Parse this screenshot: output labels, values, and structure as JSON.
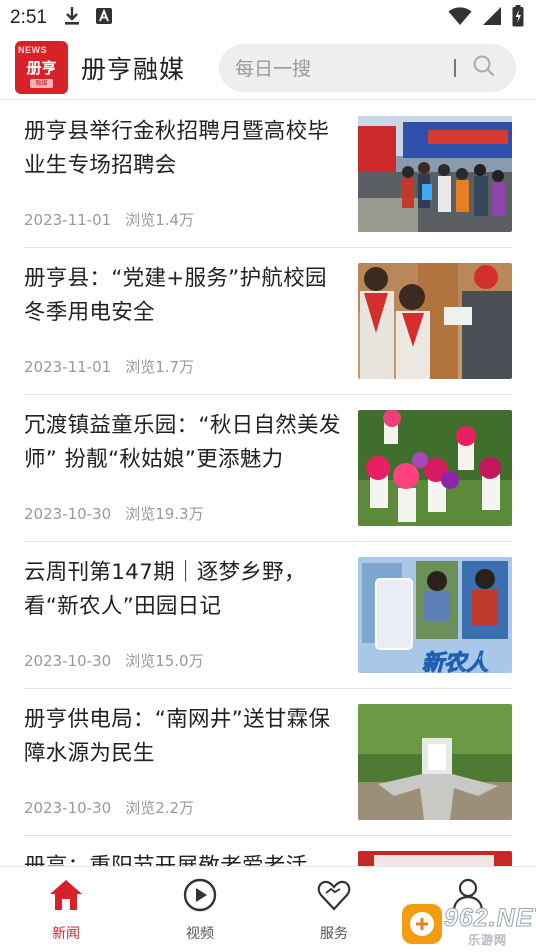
{
  "status_bar": {
    "time": "2:51",
    "icons": [
      "download-icon",
      "a-notification-icon",
      "wifi-icon",
      "signal-icon",
      "battery-icon"
    ]
  },
  "header": {
    "logo_news": "NEWS",
    "logo_text": "册亨",
    "logo_sub": "融媒",
    "title": "册亨融媒",
    "search_placeholder": "每日一搜"
  },
  "news": [
    {
      "title": "册亨县举行金秋招聘月暨高校毕业生专场招聘会",
      "date": "2023-11-01",
      "views": "浏览1.4万"
    },
    {
      "title": "册亨县：“党建+服务”护航校园冬季用电安全",
      "date": "2023-11-01",
      "views": "浏览1.7万"
    },
    {
      "title": "冗渡镇益童乐园：“秋日自然美发师” 扮靓“秋姑娘”更添魅力",
      "date": "2023-10-30",
      "views": "浏览19.3万"
    },
    {
      "title": "云周刊第147期｜逐梦乡野，看“新农人”田园日记",
      "date": "2023-10-30",
      "views": "浏览15.0万"
    },
    {
      "title": "册亨供电局：“南网井”送甘霖保障水源为民生",
      "date": "2023-10-30",
      "views": "浏览2.2万"
    },
    {
      "title": "册亨：重阳节开展敬老爱老活",
      "date": "",
      "views": ""
    }
  ],
  "thumb_texts": {
    "t4_overlay": "新农人"
  },
  "bottom_nav": [
    {
      "label": "新闻",
      "icon": "home-icon",
      "active": true
    },
    {
      "label": "视频",
      "icon": "play-circle-icon",
      "active": false
    },
    {
      "label": "服务",
      "icon": "heart-icon",
      "active": false
    },
    {
      "label": "我的",
      "icon": "user-icon",
      "active": false
    }
  ],
  "watermark": {
    "text": "962.NET",
    "sub": "乐游网"
  },
  "colors": {
    "accent": "#d8222a",
    "background": "#ffffff",
    "meta": "#999999"
  }
}
